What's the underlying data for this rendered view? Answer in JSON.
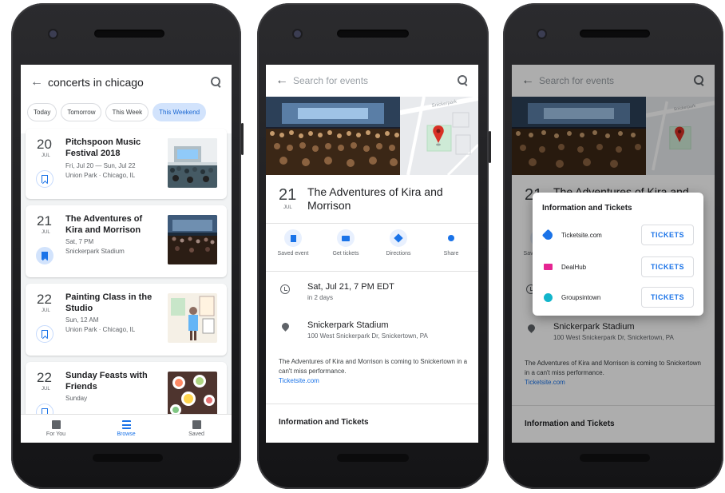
{
  "phone1": {
    "search_query": "concerts in chicago",
    "chips": [
      {
        "label": "Today",
        "active": false
      },
      {
        "label": "Tomorrow",
        "active": false
      },
      {
        "label": "This Week",
        "active": false
      },
      {
        "label": "This Weekend",
        "active": true
      }
    ],
    "events": [
      {
        "day": "20",
        "month": "JUL",
        "title": "Pitchspoon Music Festival 2018",
        "line1": "Fri, Jul 20 — Sun, Jul 22",
        "line2": "Union Park · Chicago, IL",
        "saved": false
      },
      {
        "day": "21",
        "month": "JUL",
        "title": "The Adventures of Kira and Morrison",
        "line1": "Sat, 7 PM",
        "line2": "Snickerpark Stadium",
        "saved": true
      },
      {
        "day": "22",
        "month": "JUL",
        "title": "Painting Class in the Studio",
        "line1": "Sun, 12 AM",
        "line2": "Union Park · Chicago, IL",
        "saved": false
      },
      {
        "day": "22",
        "month": "JUL",
        "title": "Sunday Feasts with Friends",
        "line1": "Sunday",
        "line2": "",
        "saved": false
      }
    ],
    "bottom_nav": [
      {
        "label": "For You",
        "icon": "for-you-icon",
        "active": false
      },
      {
        "label": "Browse",
        "icon": "browse-icon",
        "active": true
      },
      {
        "label": "Saved",
        "icon": "saved-icon",
        "active": false
      }
    ]
  },
  "detail": {
    "search_placeholder": "Search for events",
    "day": "21",
    "month": "JUL",
    "title": "The Adventures of Kira and Morrison",
    "actions": [
      {
        "label": "Saved event",
        "icon": "bookmark-icon"
      },
      {
        "label": "Get tickets",
        "icon": "ticket-icon"
      },
      {
        "label": "Directions",
        "icon": "directions-icon"
      },
      {
        "label": "Share",
        "icon": "share-icon"
      }
    ],
    "datetime": "Sat, Jul 21, 7 PM EDT",
    "relative": "in 2 days",
    "venue": "Snickerpark Stadium",
    "address": "100 West Snickerpark Dr, Snickertown, PA",
    "description": "The Adventures of Kira and Morrison is coming to Snickertown in a can't miss performance.",
    "link": "Ticketsite.com",
    "section_title": "Information and Tickets",
    "map_street": "Snickerpark"
  },
  "popup": {
    "title": "Information and Tickets",
    "providers": [
      {
        "name": "Ticketsite.com",
        "button": "TICKETS",
        "color": "#1a73e8"
      },
      {
        "name": "DealHub",
        "button": "TICKETS",
        "color": "#e52592"
      },
      {
        "name": "Groupsintown",
        "button": "TICKETS",
        "color": "#12b5cb"
      }
    ]
  },
  "colors": {
    "accent": "#1a73e8",
    "pin": "#d93025"
  }
}
